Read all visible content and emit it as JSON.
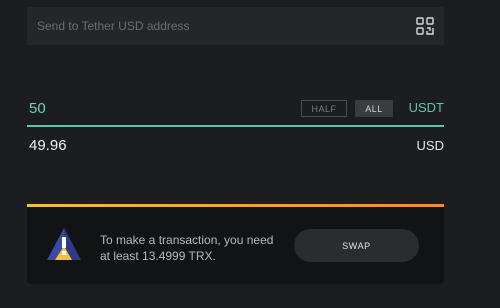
{
  "address": {
    "placeholder": "Send to Tether USD address",
    "qr_icon": "qr-scan-icon"
  },
  "amount": {
    "value": "50",
    "half_label": "HALF",
    "all_label": "ALL",
    "currency": "USDT"
  },
  "converted": {
    "value": "49.96",
    "currency": "USD"
  },
  "warning": {
    "icon": "warning-triangle-icon",
    "message": "To make a transaction, you need at least 13.4999 TRX.",
    "swap_label": "SWAP"
  },
  "colors": {
    "background": "#1c1d1f",
    "accent_green": "#5fc4a8",
    "warning_yellow": "#e8c341",
    "warning_orange": "#ef8e2d",
    "card": "#121314"
  }
}
